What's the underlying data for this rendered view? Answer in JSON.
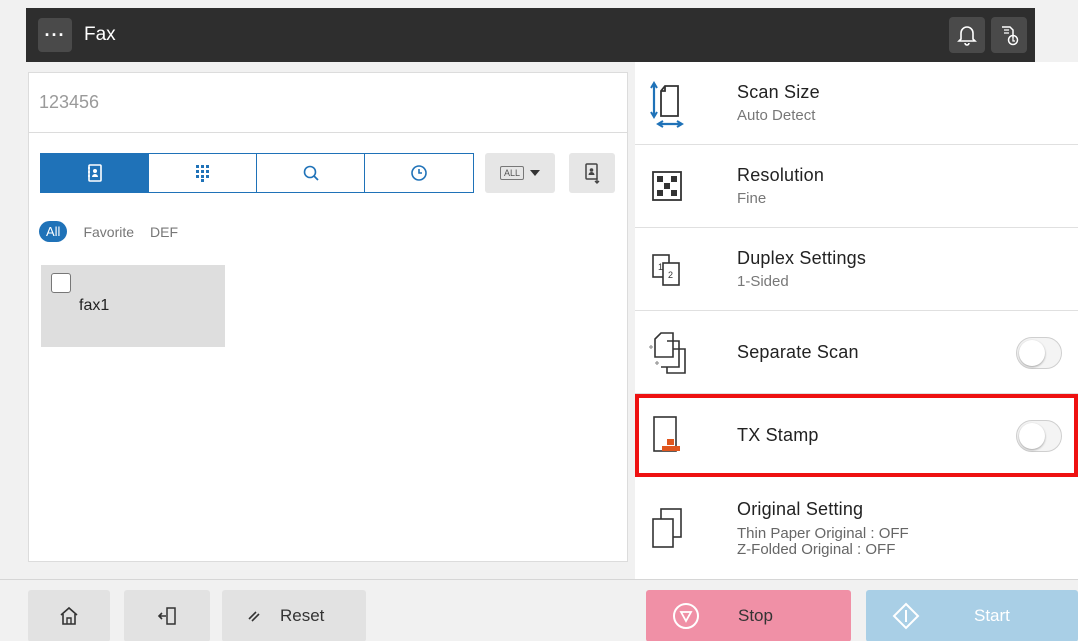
{
  "header": {
    "menu_label": "···",
    "title": "Fax"
  },
  "destination": {
    "value": "123456"
  },
  "address_tabs": [
    {
      "id": "address-book",
      "icon": "address-book-icon",
      "active": true
    },
    {
      "id": "keypad",
      "icon": "keypad-icon",
      "active": false
    },
    {
      "id": "search",
      "icon": "search-icon",
      "active": false
    },
    {
      "id": "history",
      "icon": "clock-icon",
      "active": false
    }
  ],
  "index_dropdown": {
    "label": "ALL"
  },
  "filters": {
    "all": "All",
    "favorite": "Favorite",
    "def": "DEF"
  },
  "destinations": [
    {
      "label": "fax1",
      "checked": false
    }
  ],
  "settings": {
    "scan_size": {
      "title": "Scan Size",
      "value": "Auto Detect"
    },
    "resolution": {
      "title": "Resolution",
      "value": "Fine"
    },
    "duplex": {
      "title": "Duplex Settings",
      "value": "1-Sided"
    },
    "separate_scan": {
      "title": "Separate Scan",
      "on": false
    },
    "tx_stamp": {
      "title": "TX Stamp",
      "on": false
    },
    "original_setting": {
      "title": "Original Setting",
      "line1": "Thin Paper Original : OFF",
      "line2": "Z-Folded Original : OFF"
    }
  },
  "bottom": {
    "reset_label": "Reset",
    "stop_label": "Stop",
    "start_label": "Start"
  },
  "colors": {
    "header_bg": "#2e2e2e",
    "accent_blue": "#1f72b8",
    "highlight_red": "#ee1111",
    "stop_pink": "#f090a6",
    "start_blue": "#a9cfe6",
    "stamp_orange": "#e0561e"
  }
}
